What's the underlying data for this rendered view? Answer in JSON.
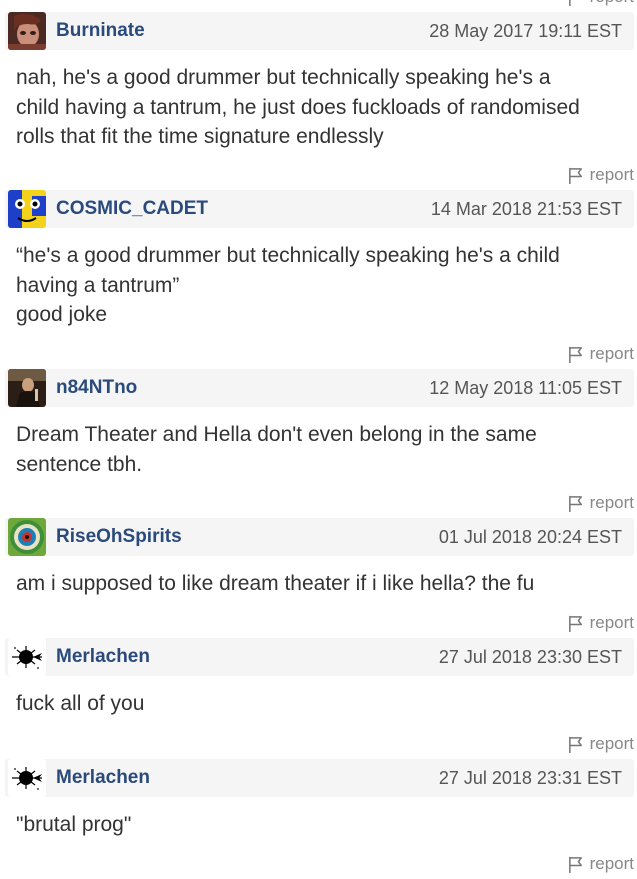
{
  "report_label": "report",
  "top_report_label": "report",
  "comments": [
    {
      "username": "Burninate",
      "timestamp": "28 May 2017 19:11 EST",
      "lines": [
        "nah, he's a good drummer but technically speaking he's a",
        "child having a tantrum, he just does fuckloads of randomised",
        "rolls that fit the time signature endlessly"
      ],
      "report": "report"
    },
    {
      "username": "COSMIC_CADET",
      "timestamp": "14 Mar 2018 21:53 EST",
      "lines": [
        "“he's a good drummer but technically speaking he's a child",
        "having a tantrum”",
        "good joke"
      ],
      "report": "report"
    },
    {
      "username": "n84NTno",
      "timestamp": "12 May 2018 11:05 EST",
      "lines": [
        "Dream Theater and Hella don't even belong in the same",
        "sentence tbh."
      ],
      "report": "report"
    },
    {
      "username": "RiseOhSpirits",
      "timestamp": "01 Jul 2018 20:24 EST",
      "lines": [
        "am i supposed to like dream theater if i like hella? the fu"
      ],
      "report": "report"
    },
    {
      "username": "Merlachen",
      "timestamp": "27 Jul 2018 23:30 EST",
      "lines": [
        "fuck all of you"
      ],
      "report": "report"
    },
    {
      "username": "Merlachen",
      "timestamp": "27 Jul 2018 23:31 EST",
      "lines": [
        "\"brutal prog\""
      ],
      "report": "report"
    }
  ]
}
